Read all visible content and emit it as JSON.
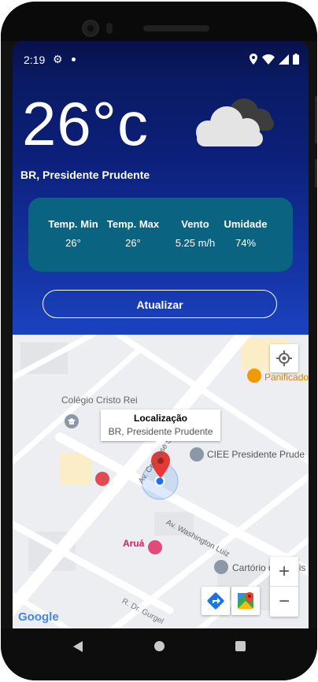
{
  "status_bar": {
    "time": "2:19"
  },
  "weather": {
    "temperature": "26°c",
    "location": "BR, Presidente Prudente",
    "stats": [
      {
        "label": "Temp. Min",
        "value": "26°"
      },
      {
        "label": "Temp. Max",
        "value": "26°"
      },
      {
        "label": "Vento",
        "value": "5.25 m/h"
      },
      {
        "label": "Umidade",
        "value": "74%"
      }
    ],
    "update_button": "Atualizar"
  },
  "map": {
    "popup_title": "Localização",
    "popup_subtitle": "BR, Presidente Prudente",
    "poi": {
      "colegio": "Colégio Cristo Rei",
      "panificadora": "Panificado",
      "ciee": "CIEE Presidente Prude",
      "arua": "Aruá",
      "cartorio": "Cartório de Regis"
    },
    "streets": {
      "soares": "Av. Cel. José Soares Ma",
      "washington": "Av. Washington Luiz",
      "gurgel": "R. Dr. Gurgel"
    },
    "attribution": "Google",
    "zoom_in": "+",
    "zoom_out": "−"
  },
  "colors": {
    "header_gradient_top": "#0a1a63",
    "header_gradient_bottom": "#1b42bf",
    "card": "#0b6382",
    "marker": "#e53935",
    "user_dot": "#1e6ff0"
  }
}
